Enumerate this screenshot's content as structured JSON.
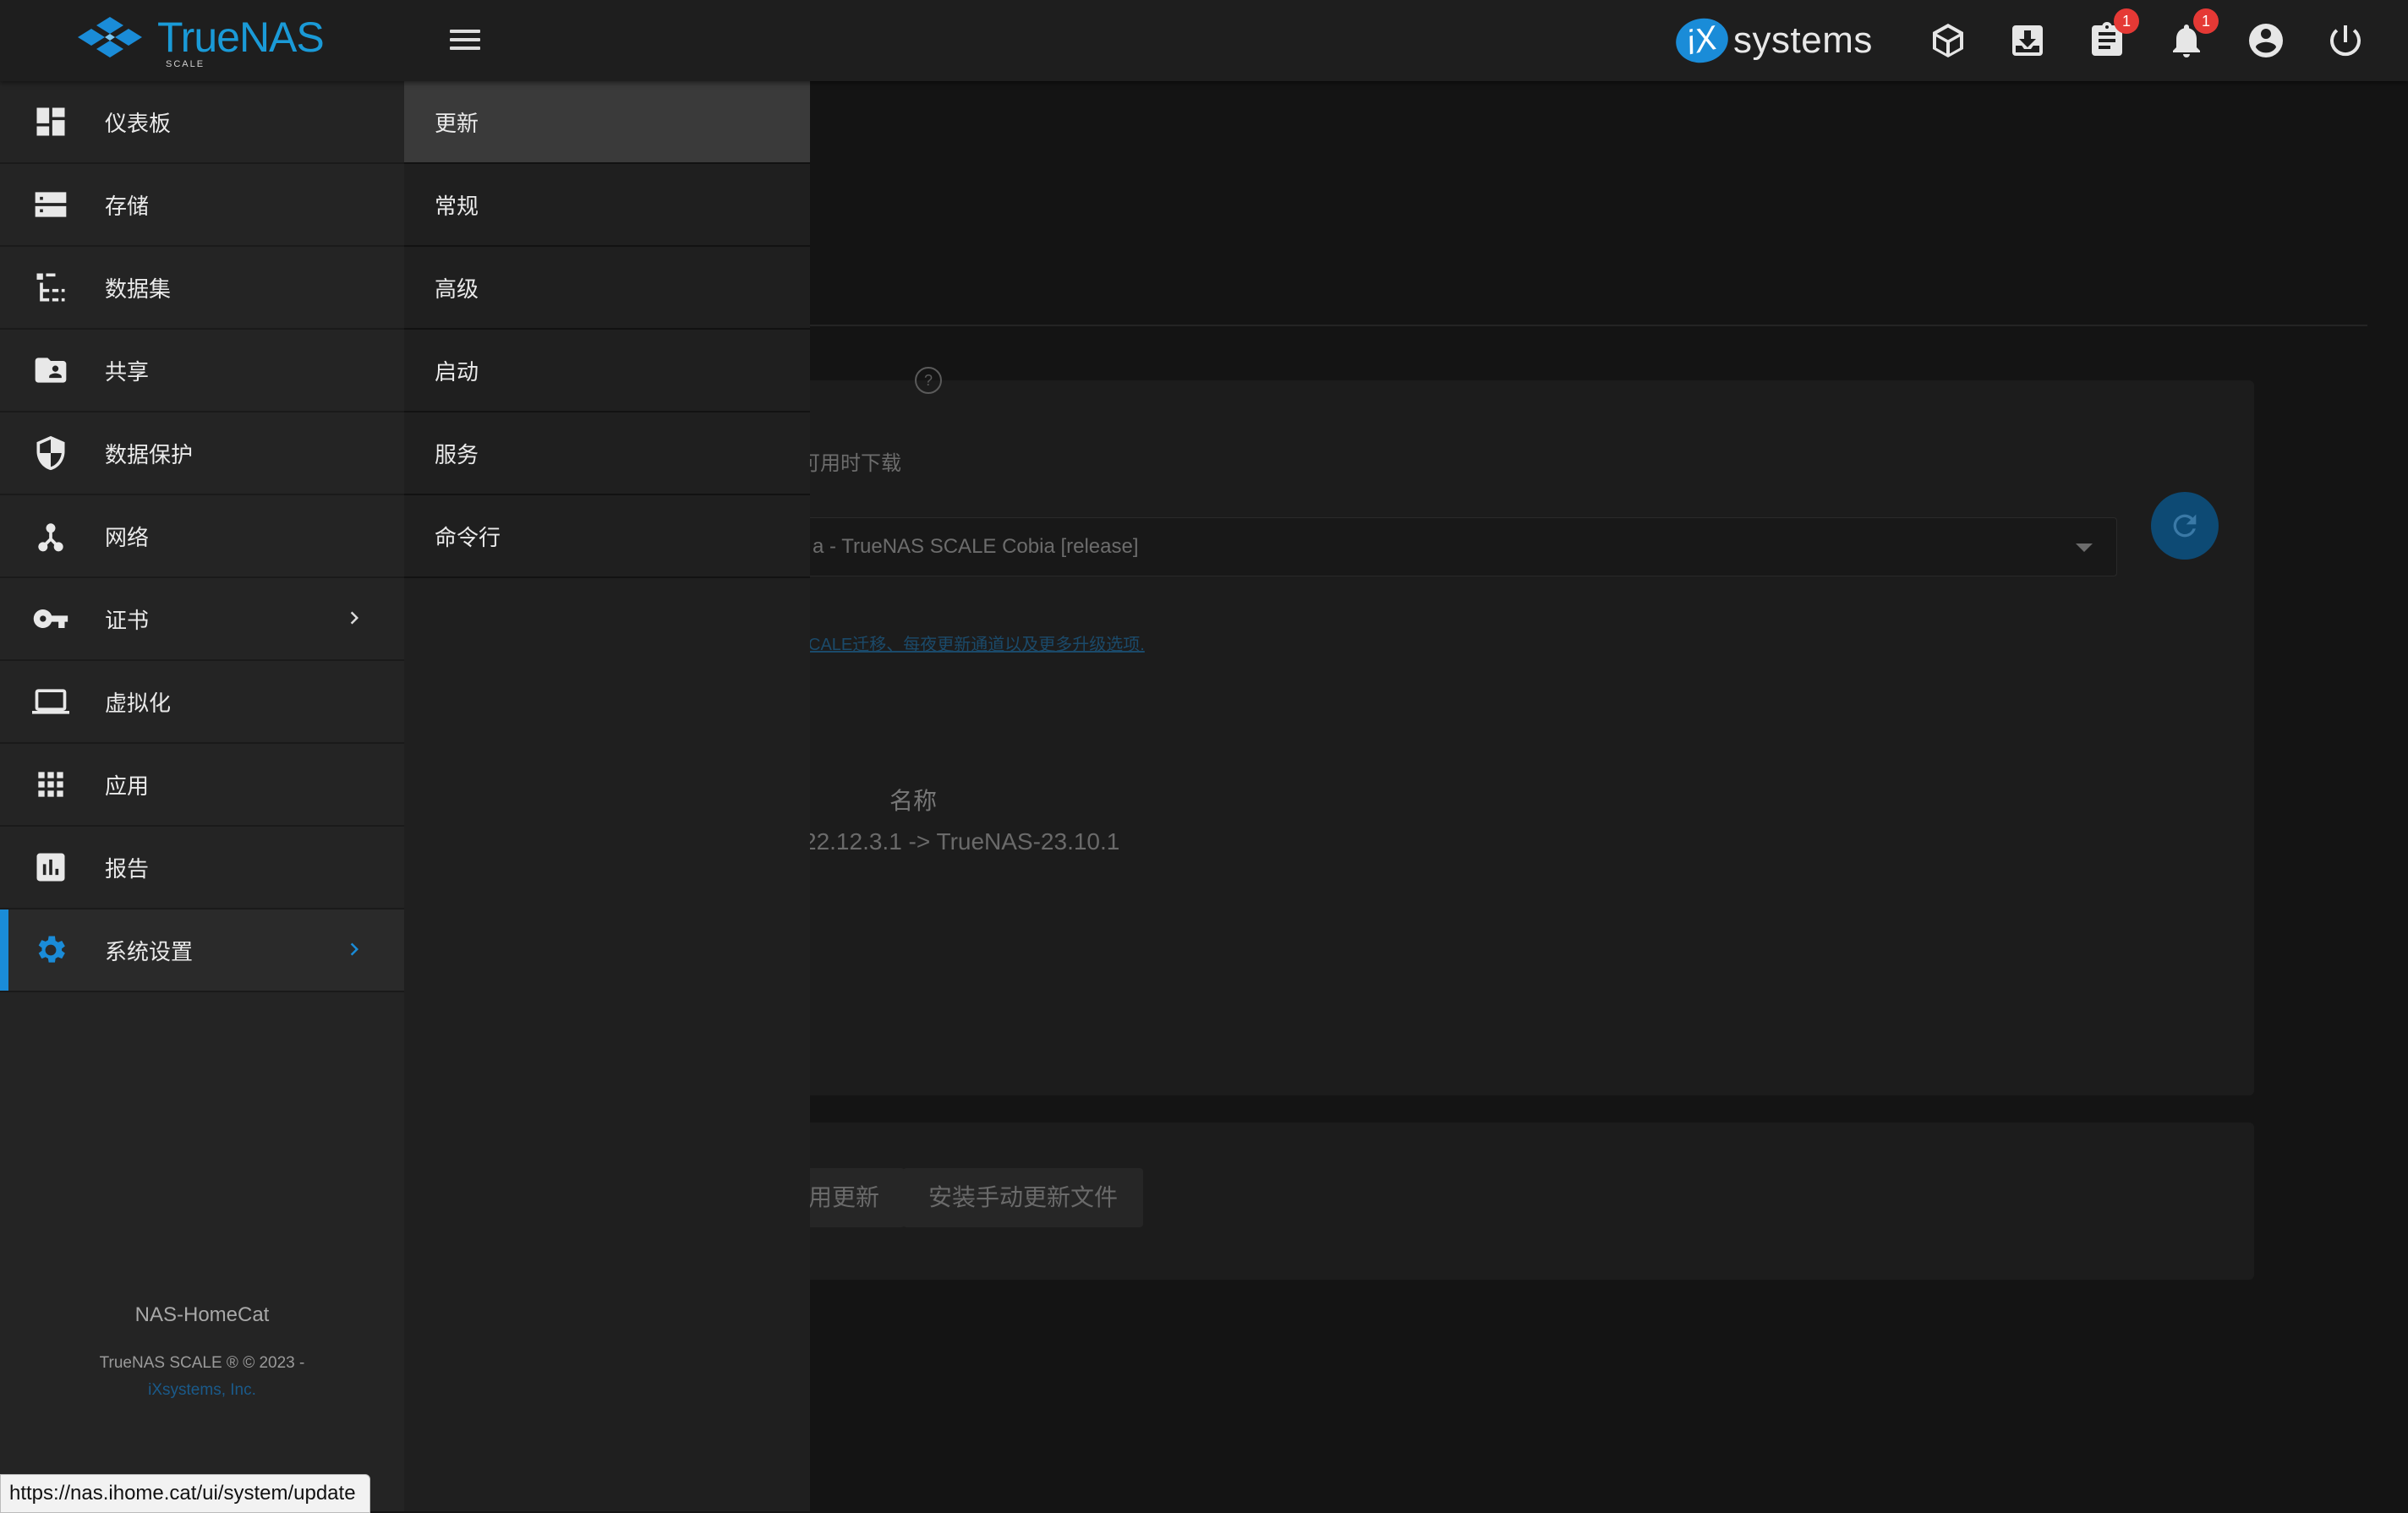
{
  "app": {
    "brand": "TrueNAS",
    "edition": "SCALE"
  },
  "vendor_logo": {
    "mark": "iX",
    "text": "systems"
  },
  "topbar": {
    "icons": [
      {
        "name": "truecommand-icon"
      },
      {
        "name": "jobs-download-icon"
      },
      {
        "name": "tasks-clipboard-icon",
        "badge": "1"
      },
      {
        "name": "notifications-bell-icon",
        "badge": "1"
      },
      {
        "name": "account-icon"
      },
      {
        "name": "power-icon"
      }
    ]
  },
  "sidebar": {
    "items": [
      {
        "label": "仪表板",
        "icon": "dashboard-icon"
      },
      {
        "label": "存储",
        "icon": "storage-icon"
      },
      {
        "label": "数据集",
        "icon": "datasets-icon"
      },
      {
        "label": "共享",
        "icon": "shares-icon"
      },
      {
        "label": "数据保护",
        "icon": "data-protection-icon"
      },
      {
        "label": "网络",
        "icon": "network-icon"
      },
      {
        "label": "证书",
        "icon": "key-icon"
      },
      {
        "label": "虚拟化",
        "icon": "laptop-icon"
      },
      {
        "label": "应用",
        "icon": "apps-icon"
      },
      {
        "label": "报告",
        "icon": "reports-icon"
      },
      {
        "label": "系统设置",
        "icon": "settings-icon"
      }
    ],
    "hostname": "NAS-HomeCat",
    "copyright": "TrueNAS SCALE ® © 2023 -",
    "copyright_link": "iXsystems, Inc."
  },
  "submenu": {
    "items": [
      {
        "label": "更新"
      },
      {
        "label": "常规"
      },
      {
        "label": "高级"
      },
      {
        "label": "启动"
      },
      {
        "label": "服务"
      },
      {
        "label": "命令行"
      }
    ]
  },
  "background": {
    "auto_download_label": "可用时下载",
    "train_value": "a - TrueNAS SCALE Cobia [release]",
    "train_link": "CALE迁移、每夜更新通道以及更多升级选项.",
    "name_header": "名称",
    "upgrade_text": "22.12.3.1 -> TrueNAS-23.10.1",
    "apply_button": "用更新",
    "manual_button": "安装手动更新文件"
  },
  "status_bar": {
    "url": "https://nas.ihome.cat/ui/system/update"
  },
  "colors": {
    "accent": "#1a8cd8",
    "topbar": "#1e1e1e",
    "sidebar": "#242424",
    "badge": "#e53935"
  }
}
